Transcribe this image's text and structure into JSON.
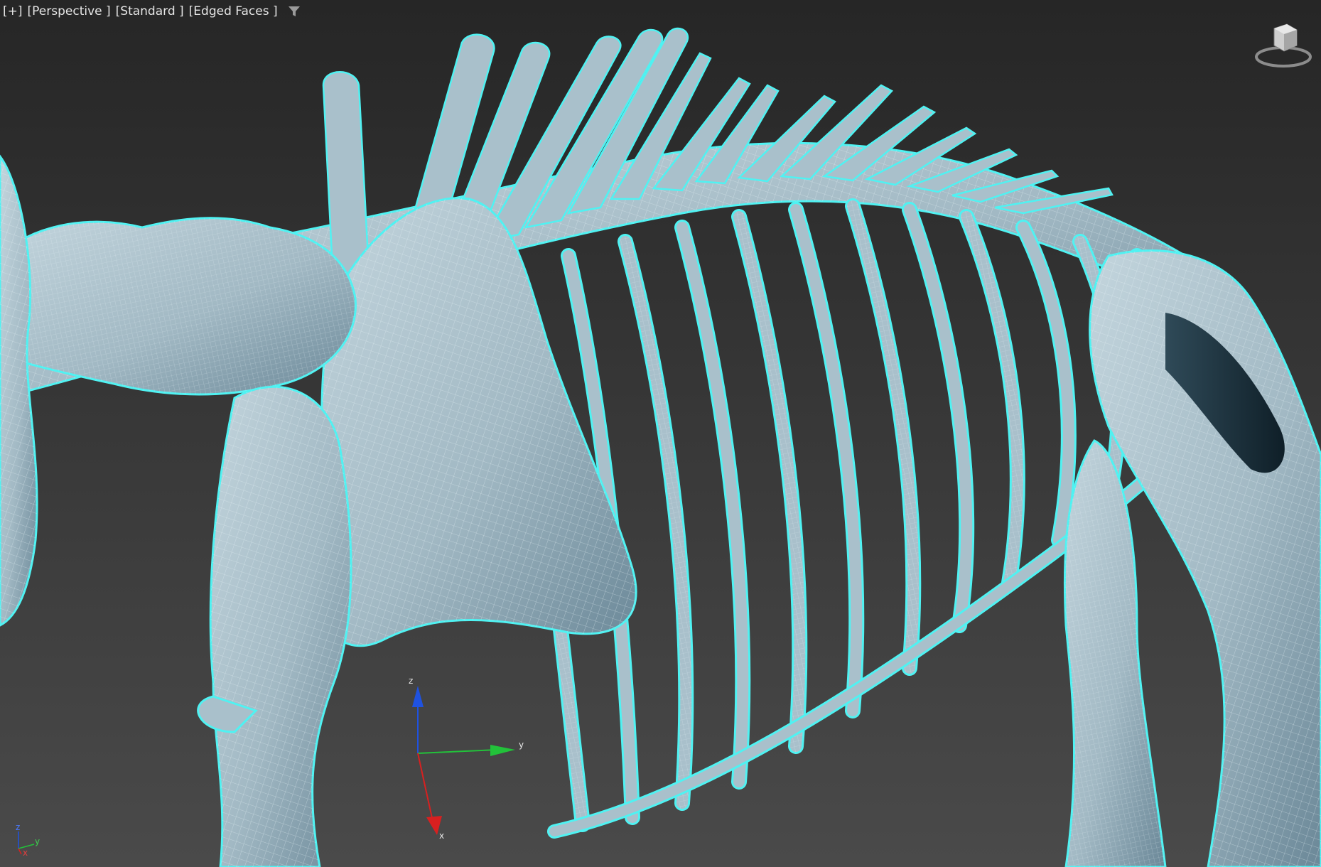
{
  "viewport": {
    "label_plus": "[+]",
    "label_view": "[Perspective ]",
    "label_shading": "[Standard ]",
    "label_style": "[Edged Faces ]",
    "filter_icon": "filter-funnel-icon",
    "background_top": "#262626",
    "background_bottom": "#4a4a4a"
  },
  "model": {
    "surface_color": "#a9c0cb",
    "shadow_color": "#4f6c7b",
    "wire_color": "#e8f4f7",
    "selection_outline": "#4ff2f2"
  },
  "gizmo": {
    "axis_z": "z",
    "axis_y": "y",
    "axis_x": "x",
    "color_z": "#1f52e0",
    "color_y": "#22c23a",
    "color_x": "#d82020"
  },
  "world_axis": {
    "z": "z",
    "y": "y",
    "x": "x"
  },
  "viewcube": {
    "icon": "viewcube-icon"
  }
}
